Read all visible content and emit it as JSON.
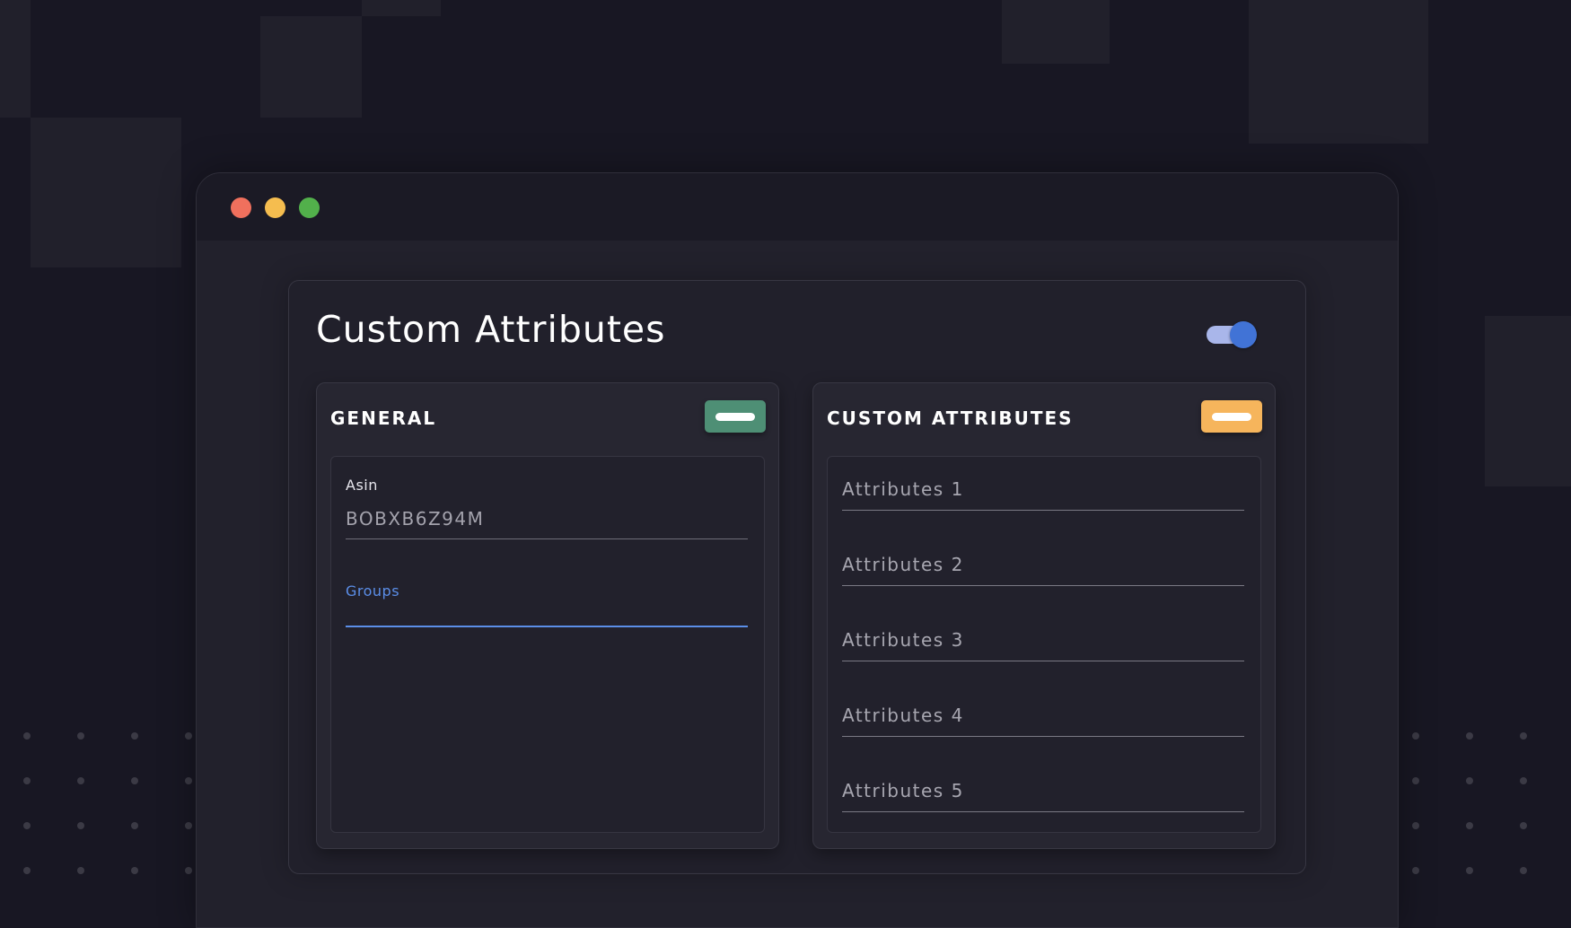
{
  "window": {
    "traffic_lights": [
      {
        "name": "close",
        "color": "#f0705d"
      },
      {
        "name": "minimize",
        "color": "#f5bd4f"
      },
      {
        "name": "maximize",
        "color": "#52b04b"
      }
    ]
  },
  "card": {
    "title": "Custom Attributes",
    "toggle": {
      "state": "on",
      "accent": "#4173d6"
    }
  },
  "general_panel": {
    "title": "GENERAL",
    "button_icon": "minus-icon",
    "button_color": "#4e8f75",
    "fields": {
      "asin": {
        "label": "Asin",
        "value": "BOBXB6Z94M"
      },
      "groups": {
        "label": "Groups",
        "value": "",
        "focused": true,
        "accent": "#5b8ee8"
      }
    }
  },
  "custom_panel": {
    "title": "CUSTOM ATTRIBUTES",
    "button_icon": "minus-icon",
    "button_color": "#f6b55c",
    "attributes": [
      {
        "placeholder": "Attributes 1"
      },
      {
        "placeholder": "Attributes 2"
      },
      {
        "placeholder": "Attributes 3"
      },
      {
        "placeholder": "Attributes 4"
      },
      {
        "placeholder": "Attributes 5"
      }
    ]
  }
}
